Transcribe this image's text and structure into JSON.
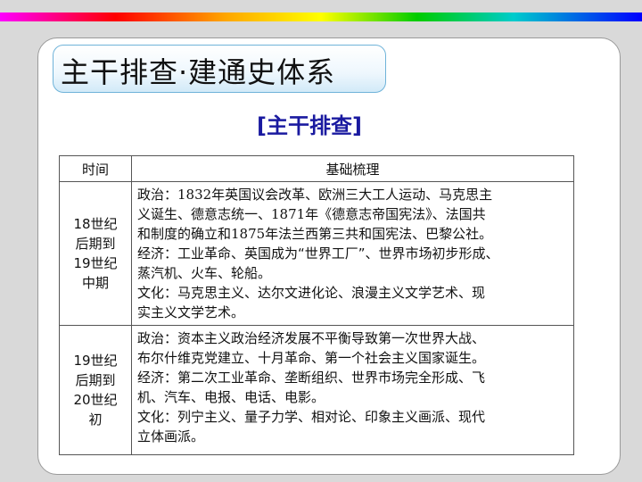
{
  "title": "主干排查·建通史体系",
  "subtitle": "[主干排查]",
  "table": {
    "headers": [
      "时间",
      "基础梳理"
    ],
    "rows": [
      {
        "period_lines": [
          "18世纪",
          "后期到",
          "19世纪",
          "中期"
        ],
        "lines": [
          "政治：1832年英国议会改革、欧洲三大工人运动、马克思主",
          "义诞生、德意志统一、1871年《德意志帝国宪法》、法国共",
          "和制度的确立和1875年法兰西第三共和国宪法、巴黎公社。",
          "经济：工业革命、英国成为“世界工厂”、世界市场初步形成、",
          "蒸汽机、火车、轮船。",
          "文化：马克思主义、达尔文进化论、浪漫主义文学艺术、现",
          "实主义文学艺术。"
        ]
      },
      {
        "period_lines": [
          "19世纪",
          "后期到",
          "20世纪",
          "初"
        ],
        "lines": [
          "政治：资本主义政治经济发展不平衡导致第一次世界大战、",
          "布尔什维克党建立、十月革命、第一个社会主义国家诞生。",
          "经济：第二次工业革命、垄断组织、世界市场完全形成、飞",
          "机、汽车、电报、电话、电影。",
          "文化：列宁主义、量子力学、相对论、印象主义画派、现代",
          "立体画派。"
        ]
      }
    ]
  },
  "colors": {
    "subtitle": "#1a1aa0",
    "title_border": "#6fb3d9"
  }
}
